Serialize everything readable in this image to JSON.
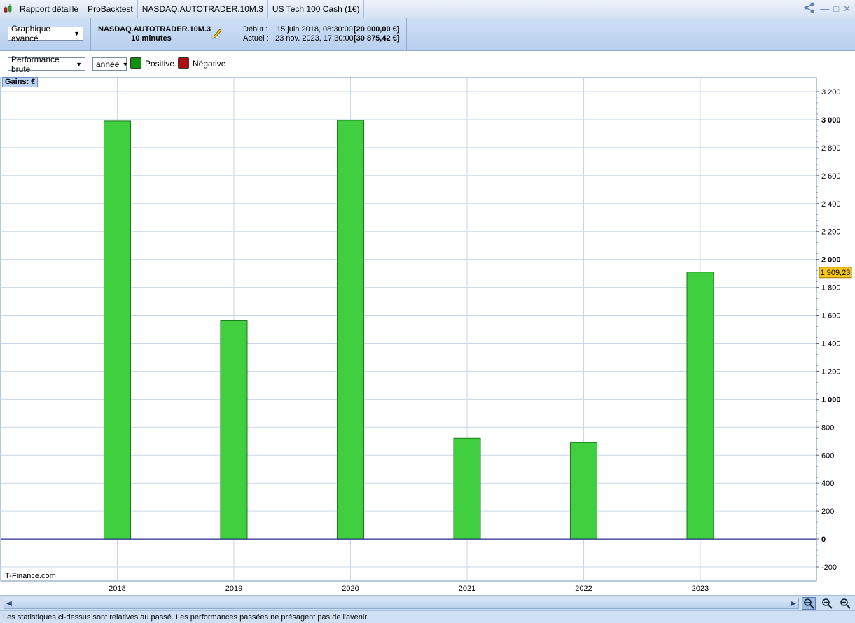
{
  "tabs": [
    {
      "label": "Rapport détaillé"
    },
    {
      "label": "ProBacktest"
    },
    {
      "label": "NASDAQ.AUTOTRADER.10M.3"
    },
    {
      "label": "US Tech 100 Cash (1€)"
    }
  ],
  "header": {
    "view_select": "Graphique avancé",
    "system_name": "NASDAQ.AUTOTRADER.10M.3",
    "timeframe": "10 minutes",
    "start_label": "Début :",
    "start_date": "15 juin 2018, 08:30:00",
    "start_capital": "[20 000,00 €]",
    "current_label": "Actuel :",
    "current_date": "23 nov. 2023, 17:30:00",
    "current_capital": "[30 875,42 €]"
  },
  "controls": {
    "metric_select": "Performance brute",
    "period_select": "année",
    "legend_positive": "Positive",
    "legend_negative": "Négative"
  },
  "colors": {
    "positive": "#3fcf3f",
    "negative": "#b01010",
    "accent": "#b9d1f2",
    "last_value_badge": "#f5c518"
  },
  "chart_data": {
    "type": "bar",
    "badge": "Gains: €",
    "categories": [
      "2018",
      "2019",
      "2020",
      "2021",
      "2022",
      "2023"
    ],
    "values": [
      2990,
      1565,
      2995,
      720,
      690,
      1909.23
    ],
    "ylim": [
      -300,
      3300
    ],
    "yticks": [
      {
        "v": 3200,
        "label": "3 200",
        "bold": false
      },
      {
        "v": 3000,
        "label": "3 000",
        "bold": true
      },
      {
        "v": 2800,
        "label": "2 800",
        "bold": false
      },
      {
        "v": 2600,
        "label": "2 600",
        "bold": false
      },
      {
        "v": 2400,
        "label": "2 400",
        "bold": false
      },
      {
        "v": 2200,
        "label": "2 200",
        "bold": false
      },
      {
        "v": 2000,
        "label": "2 000",
        "bold": true
      },
      {
        "v": 1800,
        "label": "1 800",
        "bold": false
      },
      {
        "v": 1600,
        "label": "1 600",
        "bold": false
      },
      {
        "v": 1400,
        "label": "1 400",
        "bold": false
      },
      {
        "v": 1200,
        "label": "1 200",
        "bold": false
      },
      {
        "v": 1000,
        "label": "1 000",
        "bold": true
      },
      {
        "v": 800,
        "label": "800",
        "bold": false
      },
      {
        "v": 600,
        "label": "600",
        "bold": false
      },
      {
        "v": 400,
        "label": "400",
        "bold": false
      },
      {
        "v": 200,
        "label": "200",
        "bold": false
      },
      {
        "v": 0,
        "label": "0",
        "bold": true
      },
      {
        "v": -200,
        "label": "-200",
        "bold": false
      }
    ],
    "last_value": 1909.23,
    "last_value_label": "1 909,23",
    "grid": true
  },
  "watermark": "IT-Finance.com",
  "status_text": "Les statistiques ci-dessus sont relatives au passé. Les performances passées ne présagent pas de l'avenir."
}
